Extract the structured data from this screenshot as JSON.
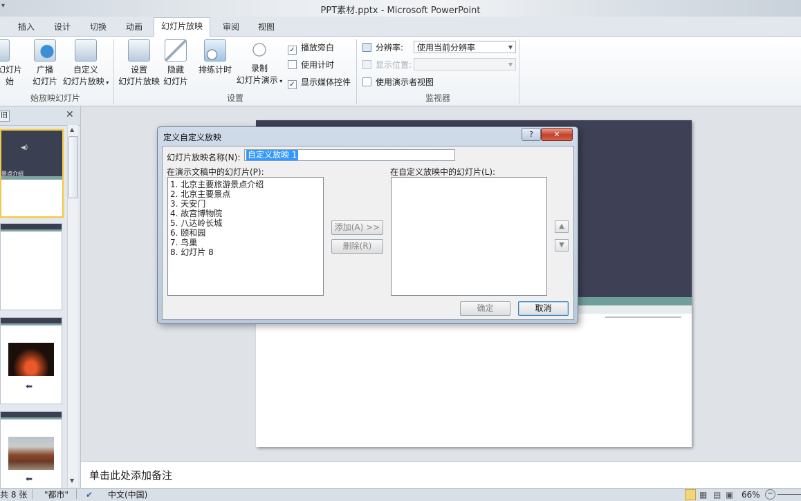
{
  "window": {
    "title": "PPT素材.pptx - Microsoft PowerPoint"
  },
  "tabs": [
    "插入",
    "设计",
    "切换",
    "动画",
    "幻灯片放映",
    "审阅",
    "视图"
  ],
  "active_tab": "幻灯片放映",
  "ribbon": {
    "start_group": {
      "partial_btn_line1": "幻灯片",
      "partial_btn_line2": "始",
      "broadcast_line1": "广播",
      "broadcast_line2": "幻灯片",
      "custom_line1": "自定义",
      "custom_line2": "幻灯片放映",
      "label": "始放映幻灯片"
    },
    "setup_group": {
      "setup_line1": "设置",
      "setup_line2": "幻灯片放映",
      "hide_line1": "隐藏",
      "hide_line2": "幻灯片",
      "rehearse": "排练计时",
      "record_line1": "录制",
      "record_line2": "幻灯片演示",
      "play_narration": "播放旁白",
      "use_timings": "使用计时",
      "show_media_controls": "显示媒体控件",
      "label": "设置"
    },
    "monitor_group": {
      "resolution_label": "分辨率:",
      "resolution_value": "使用当前分辨率",
      "display_on_label": "显示位置:",
      "display_on_value": "",
      "presenter_view": "使用演示者视图",
      "label": "监视器"
    }
  },
  "left_panel": {
    "close": "✕",
    "tab_fragment": "旧",
    "thumb1_caption": "景点介绍"
  },
  "dialog": {
    "title": "定义自定义放映",
    "help": "?",
    "close": "✕",
    "name_label": "幻灯片放映名称(N):",
    "name_value": "自定义放映 1",
    "left_list_label": "在演示文稿中的幻灯片(P):",
    "right_list_label": "在自定义放映中的幻灯片(L):",
    "slides": [
      "1.  北京主要旅游景点介绍",
      "2.  北京主要景点",
      "3.  天安门",
      "4.  故宫博物院",
      "5.  八达岭长城",
      "6.  颐和园",
      "7.  鸟巢",
      "8.  幻灯片 8"
    ],
    "add_button": "添加(A) >>",
    "remove_button": "删除(R)",
    "ok_button": "确定",
    "cancel_button": "取消"
  },
  "notes": {
    "placeholder": "单击此处添加备注"
  },
  "status_bar": {
    "slide_count": "共 8 张",
    "theme": "\"都市\"",
    "language": "中文(中国)",
    "zoom": "66%"
  }
}
